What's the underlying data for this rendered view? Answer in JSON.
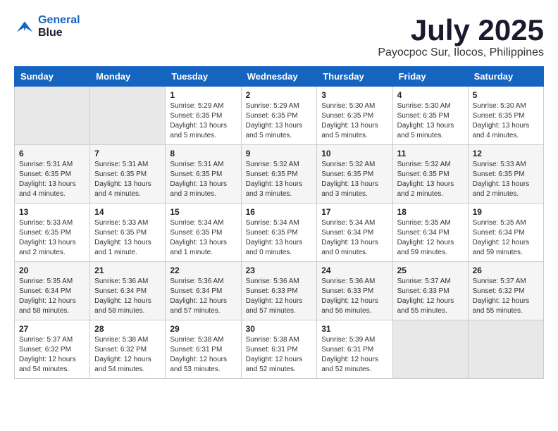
{
  "logo": {
    "line1": "General",
    "line2": "Blue"
  },
  "title": "July 2025",
  "subtitle": "Payocpoc Sur, Ilocos, Philippines",
  "weekdays": [
    "Sunday",
    "Monday",
    "Tuesday",
    "Wednesday",
    "Thursday",
    "Friday",
    "Saturday"
  ],
  "weeks": [
    [
      {
        "day": "",
        "info": ""
      },
      {
        "day": "",
        "info": ""
      },
      {
        "day": "1",
        "info": "Sunrise: 5:29 AM\nSunset: 6:35 PM\nDaylight: 13 hours and 5 minutes."
      },
      {
        "day": "2",
        "info": "Sunrise: 5:29 AM\nSunset: 6:35 PM\nDaylight: 13 hours and 5 minutes."
      },
      {
        "day": "3",
        "info": "Sunrise: 5:30 AM\nSunset: 6:35 PM\nDaylight: 13 hours and 5 minutes."
      },
      {
        "day": "4",
        "info": "Sunrise: 5:30 AM\nSunset: 6:35 PM\nDaylight: 13 hours and 5 minutes."
      },
      {
        "day": "5",
        "info": "Sunrise: 5:30 AM\nSunset: 6:35 PM\nDaylight: 13 hours and 4 minutes."
      }
    ],
    [
      {
        "day": "6",
        "info": "Sunrise: 5:31 AM\nSunset: 6:35 PM\nDaylight: 13 hours and 4 minutes."
      },
      {
        "day": "7",
        "info": "Sunrise: 5:31 AM\nSunset: 6:35 PM\nDaylight: 13 hours and 4 minutes."
      },
      {
        "day": "8",
        "info": "Sunrise: 5:31 AM\nSunset: 6:35 PM\nDaylight: 13 hours and 3 minutes."
      },
      {
        "day": "9",
        "info": "Sunrise: 5:32 AM\nSunset: 6:35 PM\nDaylight: 13 hours and 3 minutes."
      },
      {
        "day": "10",
        "info": "Sunrise: 5:32 AM\nSunset: 6:35 PM\nDaylight: 13 hours and 3 minutes."
      },
      {
        "day": "11",
        "info": "Sunrise: 5:32 AM\nSunset: 6:35 PM\nDaylight: 13 hours and 2 minutes."
      },
      {
        "day": "12",
        "info": "Sunrise: 5:33 AM\nSunset: 6:35 PM\nDaylight: 13 hours and 2 minutes."
      }
    ],
    [
      {
        "day": "13",
        "info": "Sunrise: 5:33 AM\nSunset: 6:35 PM\nDaylight: 13 hours and 2 minutes."
      },
      {
        "day": "14",
        "info": "Sunrise: 5:33 AM\nSunset: 6:35 PM\nDaylight: 13 hours and 1 minute."
      },
      {
        "day": "15",
        "info": "Sunrise: 5:34 AM\nSunset: 6:35 PM\nDaylight: 13 hours and 1 minute."
      },
      {
        "day": "16",
        "info": "Sunrise: 5:34 AM\nSunset: 6:35 PM\nDaylight: 13 hours and 0 minutes."
      },
      {
        "day": "17",
        "info": "Sunrise: 5:34 AM\nSunset: 6:34 PM\nDaylight: 13 hours and 0 minutes."
      },
      {
        "day": "18",
        "info": "Sunrise: 5:35 AM\nSunset: 6:34 PM\nDaylight: 12 hours and 59 minutes."
      },
      {
        "day": "19",
        "info": "Sunrise: 5:35 AM\nSunset: 6:34 PM\nDaylight: 12 hours and 59 minutes."
      }
    ],
    [
      {
        "day": "20",
        "info": "Sunrise: 5:35 AM\nSunset: 6:34 PM\nDaylight: 12 hours and 58 minutes."
      },
      {
        "day": "21",
        "info": "Sunrise: 5:36 AM\nSunset: 6:34 PM\nDaylight: 12 hours and 58 minutes."
      },
      {
        "day": "22",
        "info": "Sunrise: 5:36 AM\nSunset: 6:34 PM\nDaylight: 12 hours and 57 minutes."
      },
      {
        "day": "23",
        "info": "Sunrise: 5:36 AM\nSunset: 6:33 PM\nDaylight: 12 hours and 57 minutes."
      },
      {
        "day": "24",
        "info": "Sunrise: 5:36 AM\nSunset: 6:33 PM\nDaylight: 12 hours and 56 minutes."
      },
      {
        "day": "25",
        "info": "Sunrise: 5:37 AM\nSunset: 6:33 PM\nDaylight: 12 hours and 55 minutes."
      },
      {
        "day": "26",
        "info": "Sunrise: 5:37 AM\nSunset: 6:32 PM\nDaylight: 12 hours and 55 minutes."
      }
    ],
    [
      {
        "day": "27",
        "info": "Sunrise: 5:37 AM\nSunset: 6:32 PM\nDaylight: 12 hours and 54 minutes."
      },
      {
        "day": "28",
        "info": "Sunrise: 5:38 AM\nSunset: 6:32 PM\nDaylight: 12 hours and 54 minutes."
      },
      {
        "day": "29",
        "info": "Sunrise: 5:38 AM\nSunset: 6:31 PM\nDaylight: 12 hours and 53 minutes."
      },
      {
        "day": "30",
        "info": "Sunrise: 5:38 AM\nSunset: 6:31 PM\nDaylight: 12 hours and 52 minutes."
      },
      {
        "day": "31",
        "info": "Sunrise: 5:39 AM\nSunset: 6:31 PM\nDaylight: 12 hours and 52 minutes."
      },
      {
        "day": "",
        "info": ""
      },
      {
        "day": "",
        "info": ""
      }
    ]
  ]
}
